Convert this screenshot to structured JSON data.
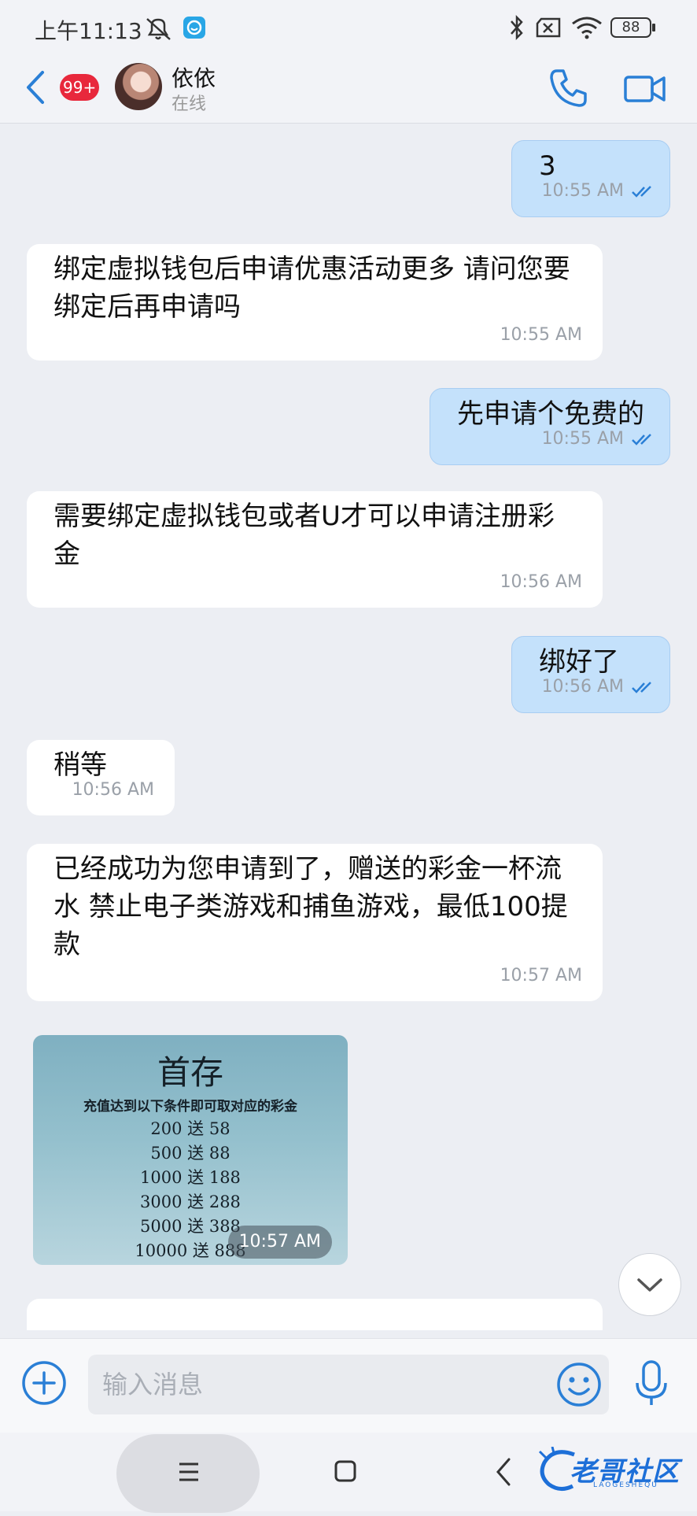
{
  "status_bar": {
    "time": "上午11:13",
    "battery": "88"
  },
  "header": {
    "unread_badge": "99+",
    "contact_name": "依依",
    "contact_status": "在线"
  },
  "messages": [
    {
      "direction": "out",
      "text": "3",
      "time": "10:55 AM"
    },
    {
      "direction": "in",
      "text": "绑定虚拟钱包后申请优惠活动更多 请问您要绑定后再申请吗",
      "time": "10:55 AM"
    },
    {
      "direction": "out",
      "text": "先申请个免费的",
      "time": "10:55 AM"
    },
    {
      "direction": "in",
      "text": "需要绑定虚拟钱包或者U才可以申请注册彩金",
      "time": "10:56 AM"
    },
    {
      "direction": "out",
      "text": "绑好了",
      "time": "10:56 AM"
    },
    {
      "direction": "in",
      "text": "稍等",
      "time": "10:56 AM"
    },
    {
      "direction": "in",
      "text": "已经成功为您申请到了，赠送的彩金一杯流水 禁止电子类游戏和捕鱼游戏，最低100提款",
      "time": "10:57 AM"
    }
  ],
  "image_message": {
    "title": "首存",
    "subtitle": "充值达到以下条件即可取对应的彩金",
    "rows": [
      "200  送  58",
      "500  送  88",
      "1000  送  188",
      "3000  送  288",
      "5000  送 388",
      "10000  送  888"
    ],
    "time": "10:57 AM"
  },
  "input": {
    "placeholder": "输入消息"
  },
  "watermark": {
    "text": "老哥社区",
    "sub": "LAOGESHEQU"
  },
  "colors": {
    "accent": "#2a7fd6",
    "outgoing_bubble": "#c4e1fb",
    "badge": "#e8283c"
  }
}
